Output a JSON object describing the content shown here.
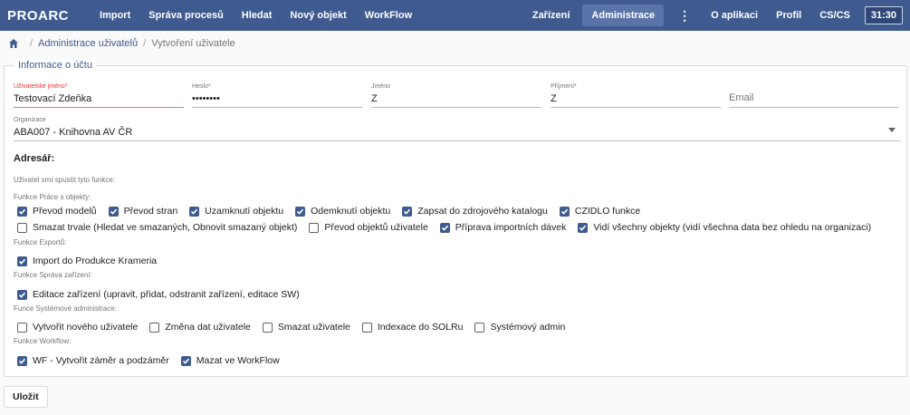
{
  "header": {
    "logo": "PROARC",
    "nav": [
      "Import",
      "Správa procesů",
      "Hledat",
      "Nový objekt",
      "WorkFlow"
    ],
    "right": {
      "devices": "Zařízení",
      "admin": "Administrace",
      "about": "O aplikaci",
      "profile": "Profil",
      "lang": "CS/CS",
      "clock": "31:30"
    }
  },
  "breadcrumb": {
    "users": "Administrace uživatelů",
    "current": "Vytvoření uživatele"
  },
  "form": {
    "legend": "Informace o účtu",
    "username": {
      "label": "Uživatelské jméno*",
      "value": "Testovací Zdeňka"
    },
    "password": {
      "label": "Heslo*",
      "value": "••••••••"
    },
    "firstname": {
      "label": "Jméno",
      "value": "Z"
    },
    "lastname": {
      "label": "Příjmení*",
      "value": "Z"
    },
    "email": {
      "placeholder": "Email"
    },
    "organization": {
      "label": "Organizace",
      "value": "ABA007 - Knihovna AV ČR"
    },
    "adresar_label": "Adresář:",
    "intro": "Uživatel smí spustit tyto funkce:",
    "sections": [
      {
        "label": "Funkce Práce s objekty:",
        "rows": [
          [
            {
              "label": "Převod modelů",
              "checked": true
            },
            {
              "label": "Převod stran",
              "checked": true
            },
            {
              "label": "Uzamknutí objektu",
              "checked": true
            },
            {
              "label": "Odemknutí objektu",
              "checked": true
            },
            {
              "label": "Zapsat do zdrojového katalogu",
              "checked": true
            },
            {
              "label": "CZIDLO funkce",
              "checked": true
            }
          ],
          [
            {
              "label": "Smazat trvale (Hledat ve smazaných, Obnovit smazaný objekt)",
              "checked": false
            },
            {
              "label": "Převod objektů uživatele",
              "checked": false
            },
            {
              "label": "Příprava importních dávek",
              "checked": true
            },
            {
              "label": "Vidí všechny objekty (vidí všechna data bez ohledu na organizaci)",
              "checked": true
            }
          ]
        ]
      },
      {
        "label": "Funkce Exportů:",
        "rows": [
          [
            {
              "label": "Import do Produkce Krameria",
              "checked": true
            }
          ]
        ]
      },
      {
        "label": "Funkce Správa zařízení:",
        "rows": [
          [
            {
              "label": "Editace zařízení (upravit, přidat, odstranit zařízení, editace SW)",
              "checked": true
            }
          ]
        ]
      },
      {
        "label": "Funce Systémové administrace:",
        "rows": [
          [
            {
              "label": "Vytvořit nového uživatele",
              "checked": false
            },
            {
              "label": "Změna dat uživatele",
              "checked": false
            },
            {
              "label": "Smazat uživatele",
              "checked": false
            },
            {
              "label": "Indexace do SOLRu",
              "checked": false
            },
            {
              "label": "Systémový admin",
              "checked": false
            }
          ]
        ]
      },
      {
        "label": "Funkce Workflow:",
        "rows": [
          [
            {
              "label": "WF - Vytvořit záměr a podzáměr",
              "checked": true
            },
            {
              "label": "Mazat ve WorkFlow",
              "checked": true
            }
          ]
        ]
      }
    ]
  },
  "save_button": "Uložit",
  "colors": {
    "primary": "#3f5a8f",
    "required": "#e53935"
  }
}
